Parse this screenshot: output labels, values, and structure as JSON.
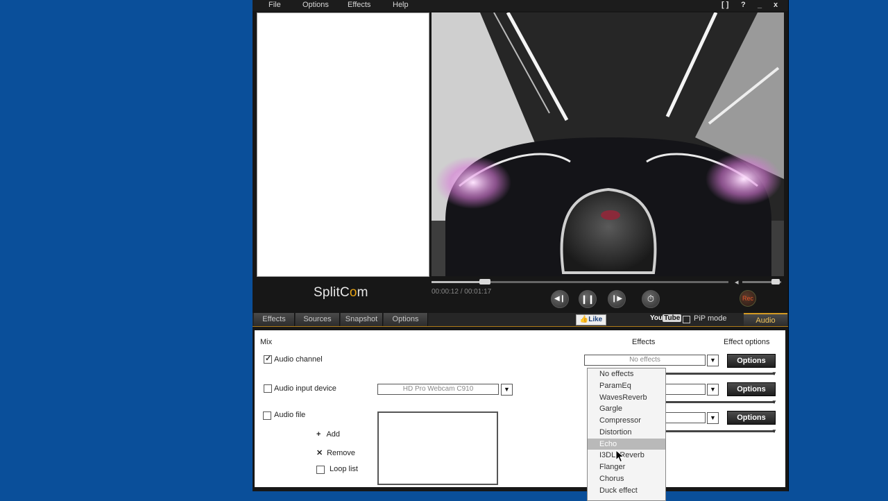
{
  "menu": {
    "items": [
      "File",
      "Options",
      "Effects",
      "Help"
    ],
    "window_buttons": [
      "[ ]",
      "?",
      "_",
      "x"
    ]
  },
  "logo": {
    "split": "Split",
    "c": "C",
    "o": "o",
    "m": "m"
  },
  "player": {
    "timecode": "00:00:12 / 00:01:17",
    "progress": 0.18,
    "volume": 0.85,
    "rec_label": "Rec"
  },
  "tabs": [
    "Effects",
    "Sources",
    "Snapshot",
    "Options"
  ],
  "toolbar": {
    "like_label": "Like",
    "youtube_you": "You",
    "youtube_tube": "Tube",
    "pip_label": "PiP mode",
    "audio_tab": "Audio"
  },
  "audio": {
    "mix_label": "Mix",
    "effects_header": "Effects",
    "effect_options_header": "Effect options",
    "audio_channel": {
      "label": "Audio channel",
      "checked": true,
      "effect": "No effects",
      "options_label": "Options"
    },
    "audio_input_device": {
      "label": "Audio input device",
      "checked": false,
      "device": "HD Pro Webcam C910",
      "options_label": "Options"
    },
    "audio_file": {
      "label": "Audio file",
      "checked": false,
      "options_label": "Options"
    },
    "add_label": "Add",
    "remove_label": "Remove",
    "loop_label": "Loop list"
  },
  "effects_dropdown": {
    "items": [
      "No effects",
      "ParamEq",
      "WavesReverb",
      "Gargle",
      "Compressor",
      "Distortion",
      "Echo",
      "I3DL2Reverb",
      "Flanger",
      "Chorus",
      "Duck effect"
    ],
    "selected": "Echo"
  },
  "colors": {
    "desktop": "#0a4f9a",
    "accent": "#d49a22",
    "rec": "#e2552a"
  }
}
